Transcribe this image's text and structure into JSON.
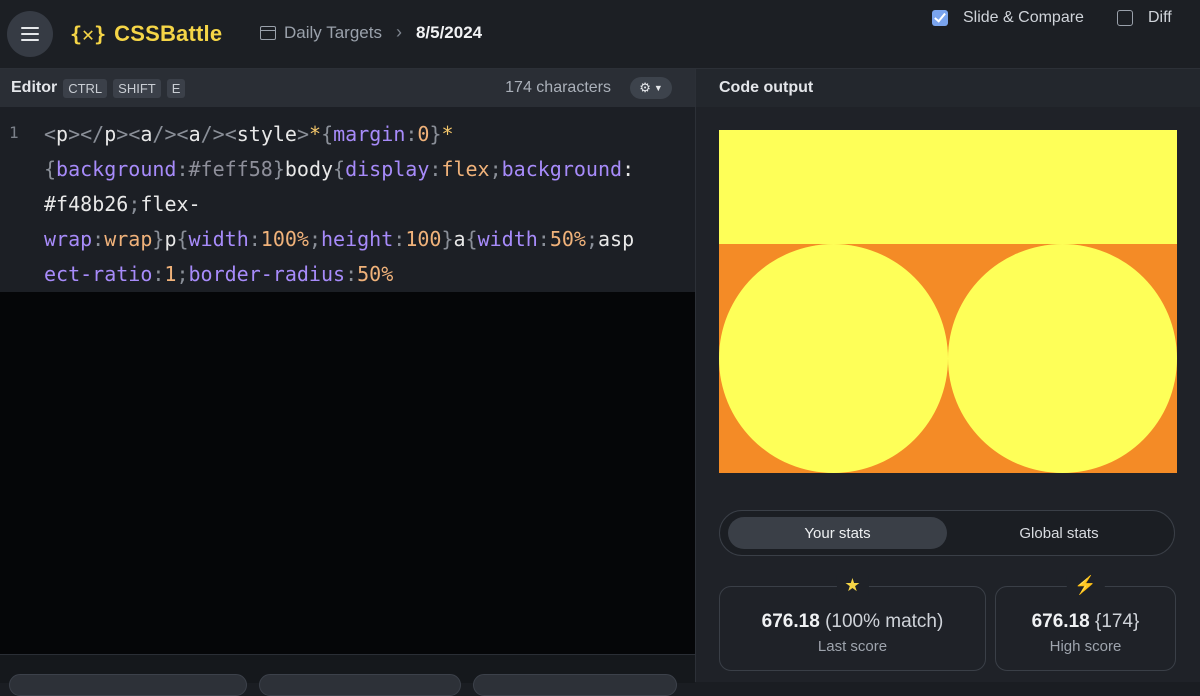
{
  "header": {
    "logo_mark": "{✕}",
    "logo_text": "CSSBattle",
    "breadcrumb_label": "Daily Targets",
    "breadcrumb_date": "8/5/2024"
  },
  "editor": {
    "title": "Editor",
    "shortcut_keys": [
      "CTRL",
      "SHIFT",
      "E"
    ],
    "char_count": "174 characters",
    "line_number": "1",
    "code": "<p></p><a/><a/><style>*{margin:0}*{background:#feff58}body{display:flex;background:#f48b26;flex-wrap:wrap}p{width:100%;height:100}a{width:50%;aspect-ratio:1;border-radius:50%"
  },
  "output": {
    "title": "Code output",
    "slide_compare_label": "Slide & Compare",
    "slide_compare_checked": true,
    "diff_label": "Diff",
    "diff_checked": false,
    "colors": {
      "background": "#f48b26",
      "foreground": "#feff58"
    }
  },
  "stats": {
    "tabs": [
      "Your stats",
      "Global stats"
    ],
    "active_tab": "Your stats",
    "last": {
      "icon": "star-icon",
      "score": "676.18",
      "extra": "(100% match)",
      "label": "Last score"
    },
    "high": {
      "icon": "bolt-icon",
      "score": "676.18",
      "extra": "{174}",
      "label": "High score"
    }
  }
}
